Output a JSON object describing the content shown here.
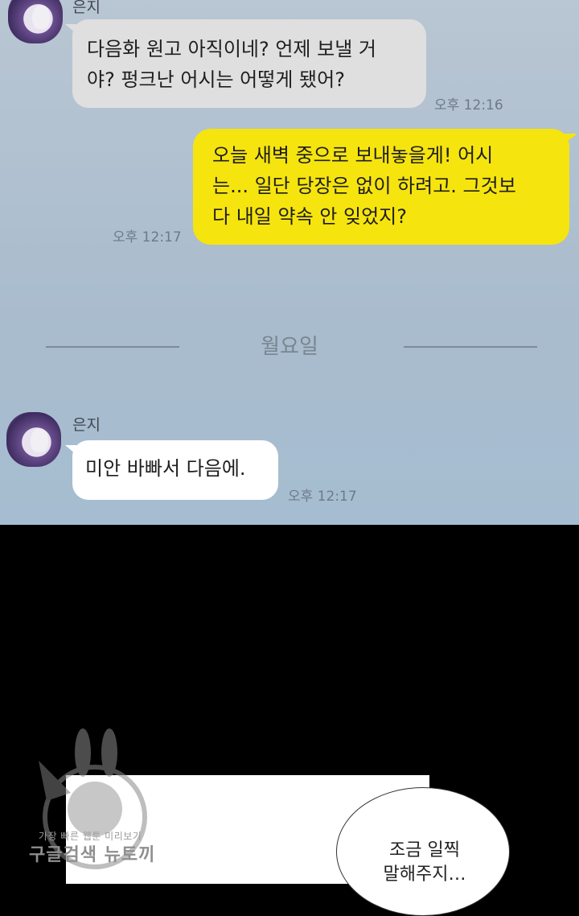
{
  "chat": {
    "messages": [
      {
        "sender": "은지",
        "text_line1": "다음화 원고 아직이네? 언제 보낼 거",
        "text_line2": "야? 펑크난 어시는 어떻게 됐어?",
        "time": "오후 12:16"
      },
      {
        "text_line1": "오늘 새벽 중으로 보내놓을게! 어시",
        "text_line2": "는... 일단 당장은 없이 하려고. 그것보",
        "text_line3": "다 내일 약속 안 잊었지?",
        "time": "오후 12:17"
      },
      {
        "sender": "은지",
        "text": "미안 바빠서 다음에.",
        "time": "오후 12:17"
      }
    ],
    "day_divider": "월요일",
    "colors": {
      "sent_bubble": "#f6e40f",
      "received_bubble": "#dfdfe0",
      "chat_bg": "#a9bccd"
    }
  },
  "panel": {
    "speech_line1": "조금 일찍",
    "speech_line2": "말해주지…"
  },
  "watermark": {
    "line1": "가장 빠른 웹툰 미리보기",
    "line2": "구글검색 뉴토끼"
  }
}
